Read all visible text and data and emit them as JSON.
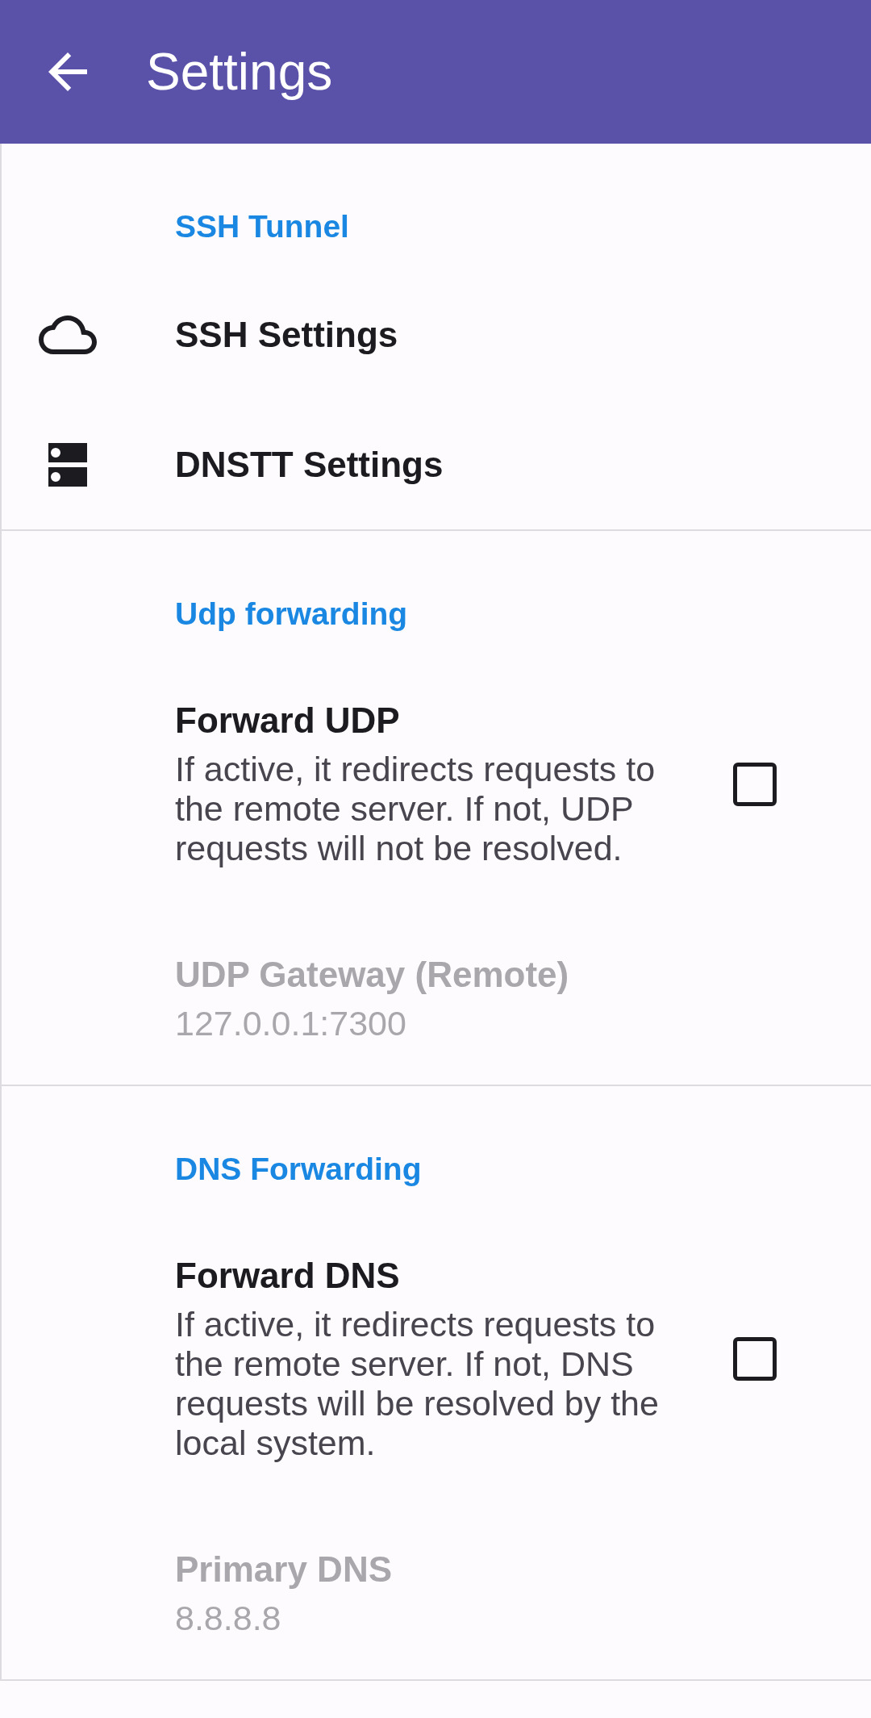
{
  "app_bar": {
    "title": "Settings"
  },
  "sections": [
    {
      "title": "SSH Tunnel",
      "items": [
        {
          "kind": "link",
          "title": "SSH Settings"
        },
        {
          "kind": "link",
          "title": "DNSTT Settings"
        }
      ]
    },
    {
      "title": "Udp forwarding",
      "items": [
        {
          "kind": "checkbox",
          "title": "Forward UDP",
          "summary": "If active, it redirects requests to the remote server. If not, UDP requests will not be resolved.",
          "checked": false
        },
        {
          "kind": "field",
          "title": "UDP Gateway (Remote)",
          "value": "127.0.0.1:7300",
          "disabled": true
        }
      ]
    },
    {
      "title": "DNS Forwarding",
      "items": [
        {
          "kind": "checkbox",
          "title": "Forward DNS",
          "summary": "If active, it redirects requests to the remote server. If not, DNS requests will be resolved by the local system.",
          "checked": false
        },
        {
          "kind": "field",
          "title": "Primary DNS",
          "value": "8.8.8.8",
          "disabled": true
        }
      ]
    }
  ]
}
